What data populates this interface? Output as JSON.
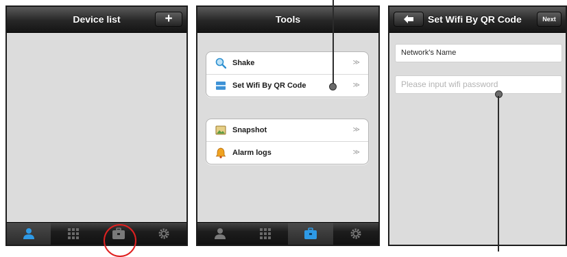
{
  "screen1": {
    "title": "Device list",
    "add_button": "+",
    "tabs": [
      {
        "icon": "person-icon",
        "active": true,
        "color": "#2e9ae6"
      },
      {
        "icon": "grid-icon",
        "active": false
      },
      {
        "icon": "toolbox-icon",
        "active": false
      },
      {
        "icon": "gear-icon",
        "active": false
      }
    ]
  },
  "screen2": {
    "title": "Tools",
    "group1": [
      {
        "label": "Shake",
        "arrow": "≫",
        "icon": "magnifier-icon"
      },
      {
        "label": "Set Wifi By QR Code",
        "arrow": "≫",
        "icon": "qr-scan-icon"
      }
    ],
    "group2": [
      {
        "label": "Snapshot",
        "arrow": "≫",
        "icon": "picture-icon"
      },
      {
        "label": "Alarm logs",
        "arrow": "≫",
        "icon": "bell-icon"
      }
    ],
    "tabs": [
      {
        "icon": "person-icon",
        "active": false
      },
      {
        "icon": "grid-icon",
        "active": false
      },
      {
        "icon": "toolbox-icon",
        "active": true,
        "color": "#2e9ae6"
      },
      {
        "icon": "gear-icon",
        "active": false
      }
    ]
  },
  "screen3": {
    "title": "Set Wifi By QR Code",
    "back_icon": "back-arrow-icon",
    "next_button": "Next",
    "network_name": "Network's Name",
    "password_placeholder": "Please input wifi password"
  },
  "colors": {
    "accent_blue": "#2e9ae6",
    "highlight_red": "#e02020",
    "background": "#dcdcdc"
  }
}
